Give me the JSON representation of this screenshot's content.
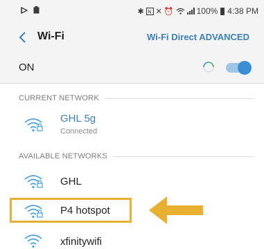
{
  "status_bar": {
    "left_icons": [
      "media-play-icon",
      "clipboard-icon"
    ],
    "right_icons": [
      "bluetooth-icon",
      "nfc-icon",
      "mute-icon",
      "alarm-icon",
      "wifi-signal-icon",
      "cell-signal-icon"
    ],
    "battery": "100%",
    "time": "4:38 PM"
  },
  "header": {
    "title": "Wi-Fi",
    "wifi_direct": "Wi-Fi Direct",
    "advanced": "ADVANCED"
  },
  "toggle_row": {
    "label": "ON",
    "state": true
  },
  "sections": {
    "current": "CURRENT NETWORK",
    "available": "AVAILABLE NETWORKS"
  },
  "current_network": {
    "name": "GHL 5g",
    "status": "Connected",
    "secured": true
  },
  "available_networks": [
    {
      "name": "GHL",
      "secured": true
    },
    {
      "name": "P4 hotspot",
      "secured": true
    },
    {
      "name": "xfinitywifi",
      "secured": false
    }
  ],
  "colors": {
    "accent": "#3a7fb0",
    "wifi_icon": "#4a9fd8",
    "highlight": "#e8b030",
    "toggle": "#3a8fd4",
    "background_header": "#f4f4f4"
  }
}
